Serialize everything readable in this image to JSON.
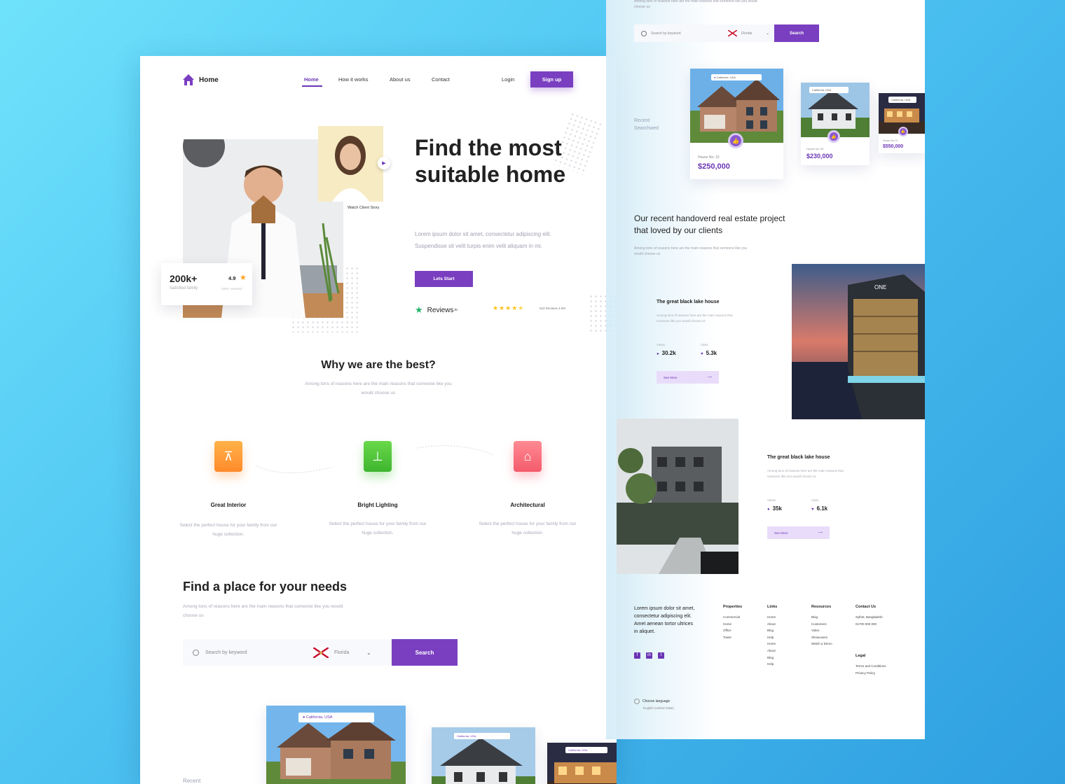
{
  "nav": {
    "logo": "Home",
    "items": [
      "Home",
      "How it works",
      "About us",
      "Contact"
    ],
    "login": "Login",
    "signup": "Sign up"
  },
  "hero": {
    "title": "Find the most suitable home",
    "subtitle": "Lorem ipsum dolor sit amet, consectetur adipiscing elit. Suspendisse sit velit turpis enim velit aliquam in mi.",
    "cta": "Lets Start",
    "watch": "Watch Client Story",
    "stat_value": "200k+",
    "stat_label": "Satisfied family",
    "rating": "4.9",
    "rating_reviews": "(400+ reviews)",
    "reviews_brand": "Reviews",
    "reviews_suffix": ".io",
    "reviews_meta": "623 Reviews  4.9/5",
    "stars": 4.5
  },
  "why": {
    "title": "Why we are the best?",
    "subtitle": "Among tons of reasons here are the main reasons that someone like you would choose us",
    "features": [
      {
        "title": "Great Interior",
        "desc": "Select the perfect house for your family from our huge collection.",
        "color": "#ff9330"
      },
      {
        "title": "Bright Lighting",
        "desc": "Select the perfect house for your family from our huge collection.",
        "color": "#55c83a"
      },
      {
        "title": "Architectural",
        "desc": "Select the perfect house for your family from our huge collection.",
        "color": "#f56b7a"
      }
    ]
  },
  "find": {
    "title": "Find a place for your needs",
    "subtitle": "Among tons of reasons here are the main reasons that someone like you would choose us",
    "search_placeholder": "Search by keyword",
    "location": "Florida",
    "search_button": "Search",
    "recent_label": "Recent",
    "pins": [
      "California, USA",
      "California, USA",
      "California, USA"
    ]
  },
  "back": {
    "top_note": "Among tons of reasons here are the main reasons that someone like you would choose us",
    "search_placeholder": "Search by keyword",
    "location": "Florida",
    "search_button": "Search",
    "recent_label": "Recent Searchwed",
    "cards": [
      {
        "pin": "California, USA",
        "house_no": "House No: 10",
        "price": "$250,000"
      },
      {
        "pin": "California, USA",
        "house_no": "House No: 02",
        "price": "$230,000"
      },
      {
        "pin": "California, USA",
        "house_no": "House No: 01",
        "price": "$550,000"
      }
    ],
    "recent_title": "Our recent handoverd real estate project that loved by our clients",
    "recent_sub": "Among tons of reasons here are the main reasons that someone like you would choose us",
    "projects": [
      {
        "title": "The great black lake house",
        "desc": "Among tons of reasons here are the main reasons that someone like you would choose us",
        "views_label": "Views",
        "views": "30.2k",
        "likes_label": "Likes",
        "likes": "5.3k",
        "more": "See More"
      },
      {
        "title": "The great black lake house",
        "desc": "Among tons of reasons here are the main reasons that someone like you would choose us",
        "views_label": "Views",
        "views": "35k",
        "likes_label": "Likes",
        "likes": "6.1k",
        "more": "See More"
      }
    ],
    "footer": {
      "about": "Lorem ipsum dolor sit amet, consectetur adipiscing elit. Amet aenean tortor ultrices in aliquet.",
      "properties_title": "Properties",
      "properties": [
        "Commercial",
        "Home",
        "Office",
        "Tower"
      ],
      "links_title": "Links",
      "links": [
        "Home",
        "About",
        "Blog",
        "Help",
        "Home",
        "About",
        "Blog",
        "Help"
      ],
      "resources_title": "Resources",
      "resources": [
        "Blog",
        "Customers",
        "Video",
        "Showcases",
        "Watch a Demo"
      ],
      "contact_title": "Contact Us",
      "contact": [
        "Sylhet, Bangladesh",
        "01700 000 000"
      ],
      "legal_title": "Legal",
      "legal": [
        "Terms and Conditions",
        "Privacy Policy"
      ],
      "lang_label": "Choose language",
      "lang_value": "English (United State)"
    }
  },
  "colors": {
    "primary": "#7a3fc0",
    "accent_star": "#ffc21a",
    "bg_gradient_start": "#6fe2fb",
    "bg_gradient_end": "#2f9fe0"
  }
}
